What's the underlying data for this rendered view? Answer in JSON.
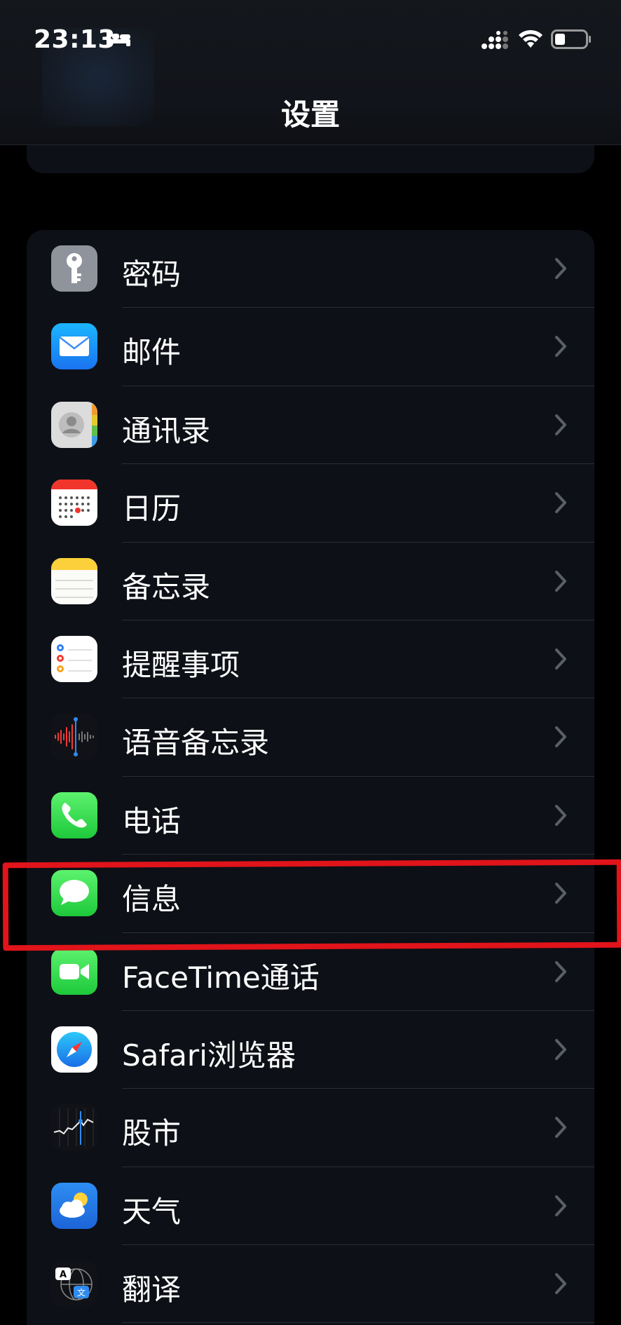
{
  "status_bar": {
    "time": "23:13"
  },
  "nav": {
    "title": "设置"
  },
  "settings": [
    {
      "label": "密码",
      "icon": "key-icon"
    },
    {
      "label": "邮件",
      "icon": "mail-icon"
    },
    {
      "label": "通讯录",
      "icon": "contacts-icon"
    },
    {
      "label": "日历",
      "icon": "calendar-icon"
    },
    {
      "label": "备忘录",
      "icon": "notes-icon"
    },
    {
      "label": "提醒事项",
      "icon": "reminders-icon"
    },
    {
      "label": "语音备忘录",
      "icon": "voice-memos-icon"
    },
    {
      "label": "电话",
      "icon": "phone-icon"
    },
    {
      "label": "信息",
      "icon": "messages-icon"
    },
    {
      "label": "FaceTime通话",
      "icon": "facetime-icon"
    },
    {
      "label": "Safari浏览器",
      "icon": "safari-icon"
    },
    {
      "label": "股市",
      "icon": "stocks-icon"
    },
    {
      "label": "天气",
      "icon": "weather-icon"
    },
    {
      "label": "翻译",
      "icon": "translate-icon"
    }
  ],
  "colors": {
    "highlight": "#e0141a",
    "group_bg": "#0d1016",
    "chevron": "#5a5e66"
  }
}
